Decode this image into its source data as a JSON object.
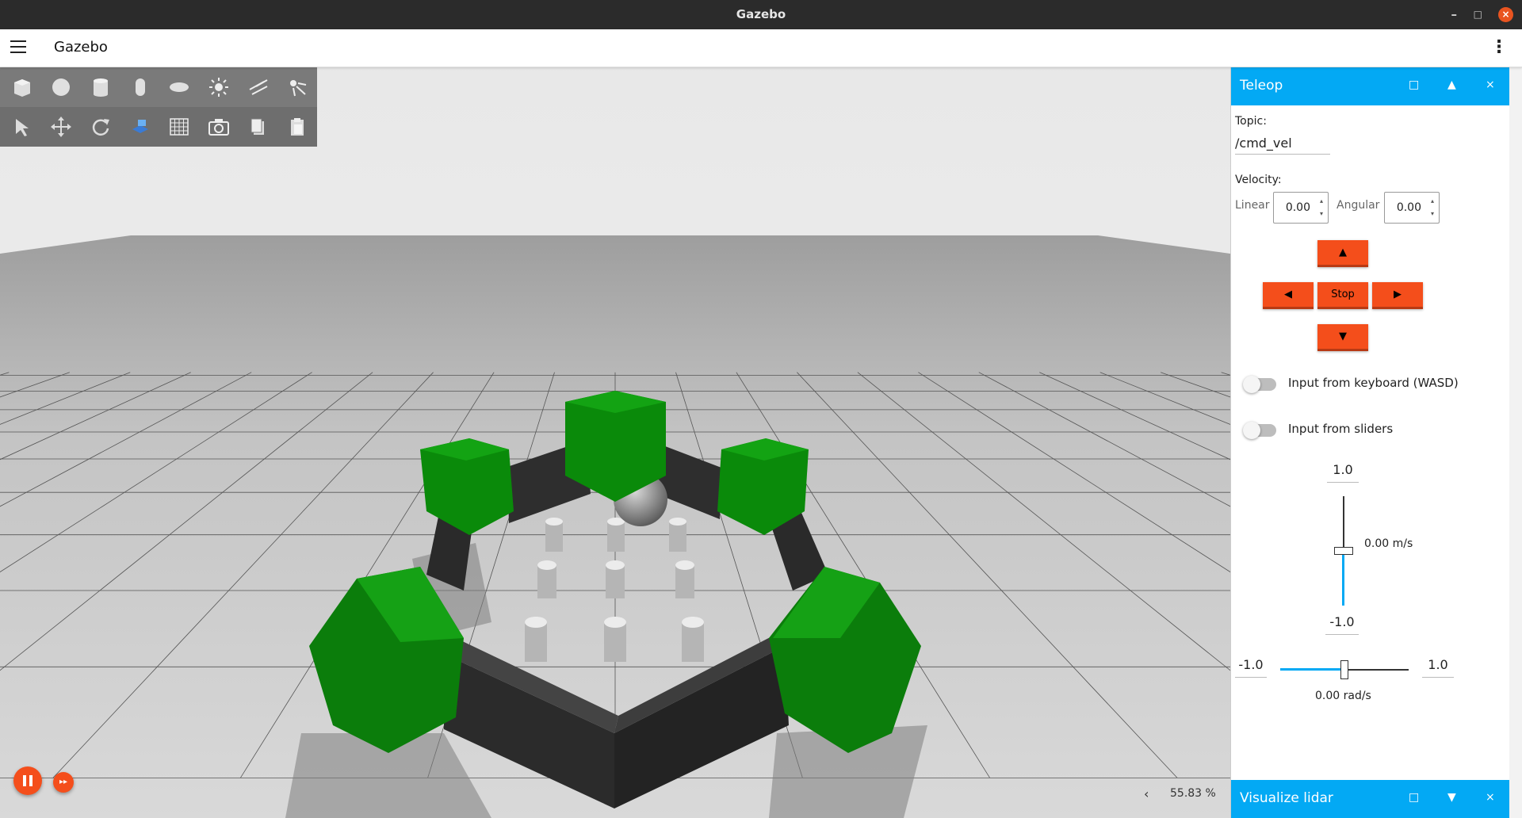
{
  "window": {
    "title": "Gazebo",
    "minimize": "–",
    "maximize": "□",
    "close": "×"
  },
  "appbar": {
    "title": "Gazebo",
    "menu_icon": "hamburger-icon",
    "more_icon": "more-vert-icon",
    "more": "⋮"
  },
  "toolbar": {
    "row1": [
      "box-icon",
      "sphere-icon",
      "cylinder-icon",
      "capsule-icon",
      "ellipsoid-icon",
      "sun-icon",
      "directional-light-icon",
      "spot-light-icon"
    ],
    "row2": [
      "select-icon",
      "translate-icon",
      "rotate-icon",
      "view-angle-icon",
      "grid-icon",
      "camera-icon",
      "copy-icon",
      "paste-icon"
    ]
  },
  "playback": {
    "pause_icon": "pause-icon",
    "step_icon": "fast-forward-icon",
    "step": "▸▸"
  },
  "status": {
    "zoom": "55.83 %",
    "chevron": "‹"
  },
  "teleop": {
    "title": "Teleop",
    "header_buttons": [
      "□",
      "▲",
      "×"
    ],
    "topic_label": "Topic:",
    "topic_value": "/cmd_vel",
    "velocity_label": "Velocity:",
    "linear_label": "Linear",
    "linear_value": "0.00",
    "angular_label": "Angular",
    "angular_value": "0.00",
    "spin_up": "▴",
    "spin_down": "▾",
    "forward": "▲",
    "left": "◀",
    "stop": "Stop",
    "right": "▶",
    "backward": "▼",
    "keyboard_label": "Input from keyboard (WASD)",
    "keyboard_on": false,
    "sliders_label": "Input from sliders",
    "sliders_on": false,
    "linear_max": "1.0",
    "linear_min": "-1.0",
    "linear_readout": "0.00 m/s",
    "linear_level": 0.5,
    "angular_min": "-1.0",
    "angular_max": "1.0",
    "angular_readout": "0.00 rad/s",
    "angular_level": 0.5
  },
  "lidar": {
    "title": "Visualize lidar",
    "header_buttons": [
      "□",
      "▼",
      "×"
    ]
  },
  "colors": {
    "accent": "#03a9f4",
    "button": "#f44e1b",
    "shrub": "#0a8a0a",
    "wall": "#2e2e2e"
  }
}
